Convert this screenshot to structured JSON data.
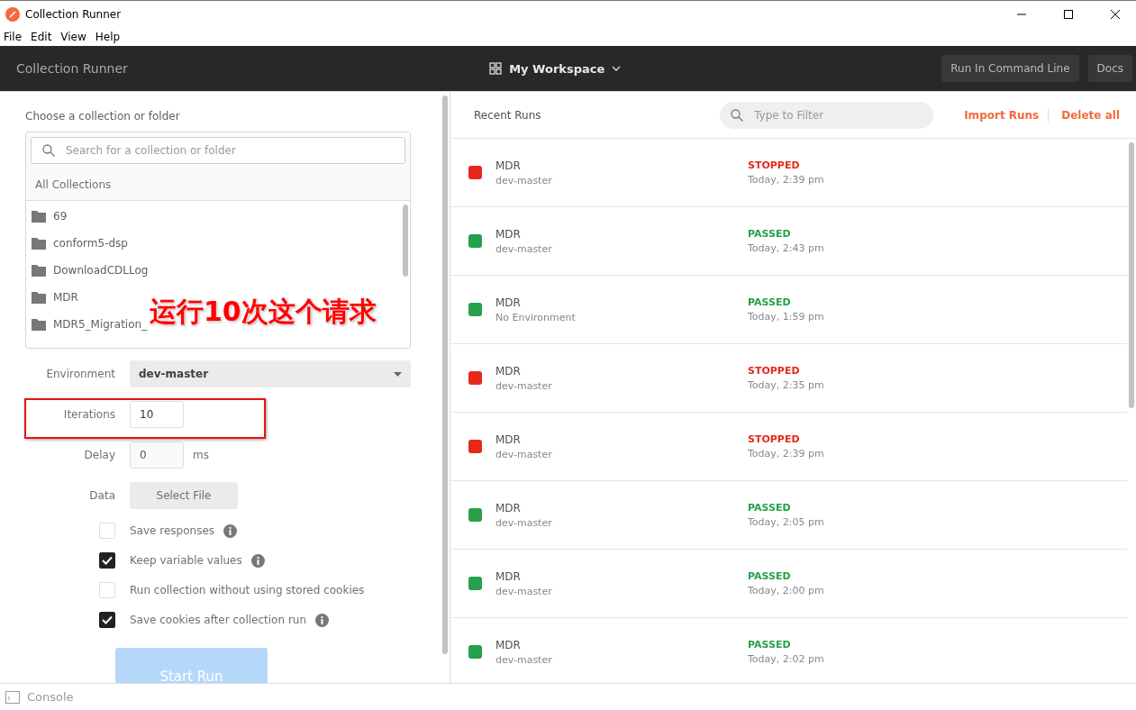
{
  "window": {
    "title": "Collection Runner"
  },
  "menu": [
    "File",
    "Edit",
    "View",
    "Help"
  ],
  "header": {
    "title": "Collection Runner",
    "workspace": "My Workspace",
    "buttons": [
      "Run In Command Line",
      "Docs"
    ]
  },
  "chooser": {
    "label": "Choose a collection or folder",
    "search": {
      "placeholder": "Search for a collection or folder"
    },
    "breadcrumb": "All Collections",
    "folders": [
      "69",
      "conform5-dsp",
      "DownloadCDLLog",
      "MDR",
      "MDR5_Migration_"
    ]
  },
  "annotation": {
    "text": "运行10次这个请求"
  },
  "settings": {
    "environment": {
      "label": "Environment",
      "value": "dev-master"
    },
    "iterations": {
      "label": "Iterations",
      "value": "10",
      "highlighted": true
    },
    "delay": {
      "label": "Delay",
      "value": "0",
      "unit": "ms"
    },
    "data": {
      "label": "Data",
      "button": "Select File"
    },
    "options": [
      {
        "label": "Save responses",
        "checked": false,
        "info": true
      },
      {
        "label": "Keep variable values",
        "checked": true,
        "info": true
      },
      {
        "label": "Run collection without using stored cookies",
        "checked": false,
        "info": false
      },
      {
        "label": "Save cookies after collection run",
        "checked": true,
        "info": true
      }
    ],
    "start": "Start Run"
  },
  "recent": {
    "title": "Recent Runs",
    "filter": {
      "placeholder": "Type to Filter"
    },
    "actions": [
      "Import Runs",
      "Delete all"
    ],
    "runs": [
      {
        "name": "MDR",
        "environment": "dev-master",
        "status": "STOPPED",
        "color": "#e8271c",
        "time": "Today, 2:39 pm"
      },
      {
        "name": "MDR",
        "environment": "dev-master",
        "status": "PASSED",
        "color": "#26a04a",
        "time": "Today, 2:43 pm"
      },
      {
        "name": "MDR",
        "environment": "No Environment",
        "status": "PASSED",
        "color": "#26a04a",
        "time": "Today, 1:59 pm"
      },
      {
        "name": "MDR",
        "environment": "dev-master",
        "status": "STOPPED",
        "color": "#e8271c",
        "time": "Today, 2:35 pm"
      },
      {
        "name": "MDR",
        "environment": "dev-master",
        "status": "STOPPED",
        "color": "#e8271c",
        "time": "Today, 2:39 pm"
      },
      {
        "name": "MDR",
        "environment": "dev-master",
        "status": "PASSED",
        "color": "#26a04a",
        "time": "Today, 2:05 pm"
      },
      {
        "name": "MDR",
        "environment": "dev-master",
        "status": "PASSED",
        "color": "#26a04a",
        "time": "Today, 2:00 pm"
      },
      {
        "name": "MDR",
        "environment": "dev-master",
        "status": "PASSED",
        "color": "#26a04a",
        "time": "Today, 2:02 pm"
      }
    ]
  },
  "status_bar": {
    "console": "Console"
  }
}
